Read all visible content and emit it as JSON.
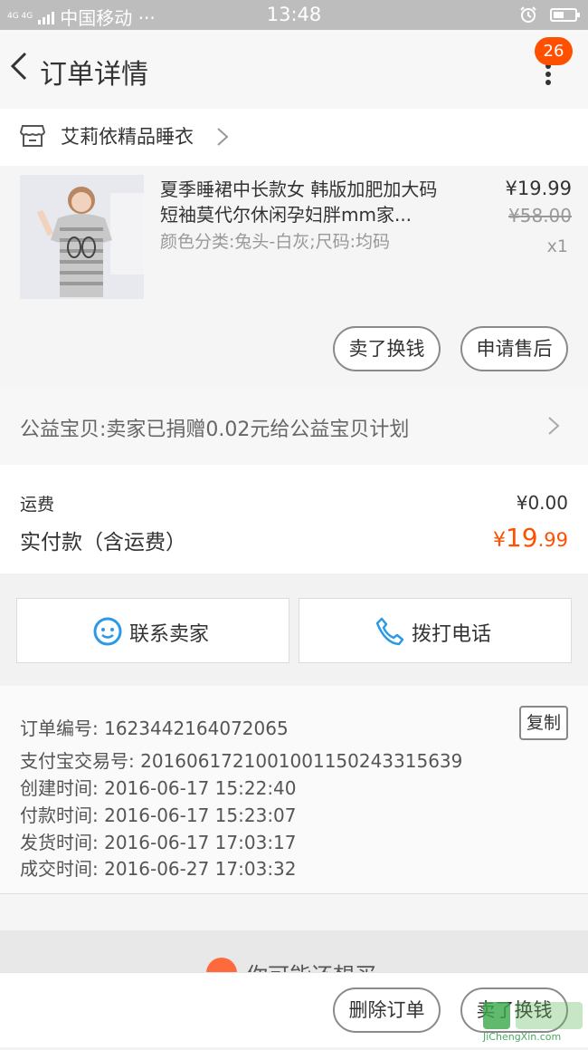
{
  "status_bar": {
    "network": "4G 4G",
    "carrier": "中国移动 ···",
    "time": "13:48"
  },
  "nav": {
    "title": "订单详情",
    "badge_count": "26"
  },
  "shop": {
    "name": "艾莉依精品睡衣"
  },
  "item": {
    "title": "夏季睡裙中长款女 韩版加肥加大码短袖莫代尔休闲孕妇胖mm家...",
    "spec": "颜色分类:兔头-白灰;尺码:均码",
    "price": "¥19.99",
    "original_price": "¥58.00",
    "quantity": "x1",
    "sell_button": "卖了换钱",
    "after_sale_button": "申请售后"
  },
  "charity": {
    "text": "公益宝贝:卖家已捐赠0.02元给公益宝贝计划"
  },
  "totals": {
    "shipping_label": "运费",
    "shipping_value": "¥0.00",
    "paid_label": "实付款（含运费）",
    "paid_currency": "¥",
    "paid_integer": "19",
    "paid_decimal": ".99"
  },
  "contact": {
    "contact_seller": "联系卖家",
    "call_phone": "拨打电话"
  },
  "order_info": {
    "order_no": "订单编号: 1623442164072065",
    "copy_label": "复制",
    "alipay_no": "支付宝交易号: 2016061721001001150243315639",
    "created": "创建时间: 2016-06-17 15:22:40",
    "paid": "付款时间: 2016-06-17 15:23:07",
    "shipped": "发货时间: 2016-06-17 17:03:17",
    "completed": "成交时间: 2016-06-27 17:03:32"
  },
  "recommend": {
    "text": "你可能还想买"
  },
  "bottom_bar": {
    "delete_order": "删除订单",
    "sell": "卖了换钱"
  },
  "watermark": {
    "text": "JiChengXin.com"
  },
  "colors": {
    "accent": "#ff5000",
    "link_blue": "#2a9ae8"
  }
}
